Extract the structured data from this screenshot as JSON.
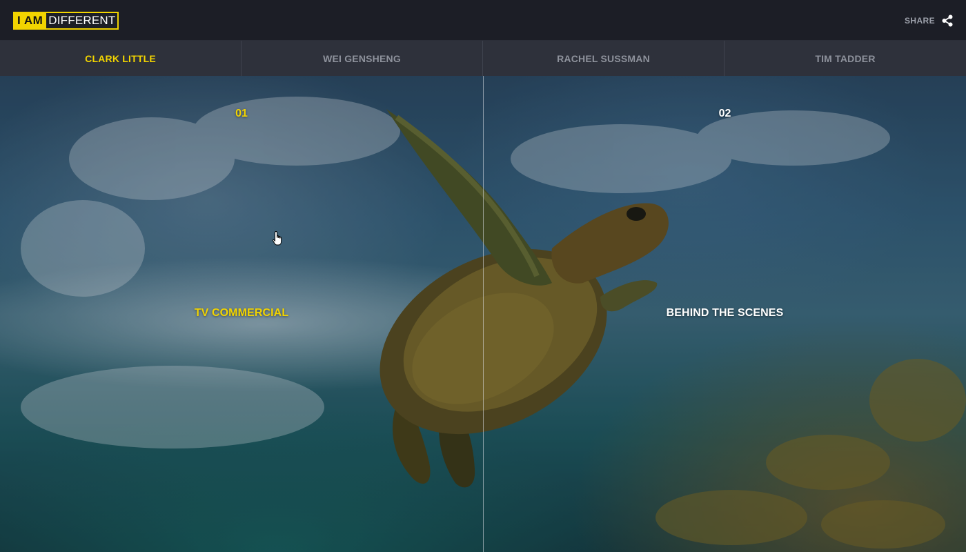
{
  "logo": {
    "part1": "I AM",
    "part2": "DIFFERENT"
  },
  "header": {
    "share_label": "SHARE"
  },
  "tabs": [
    {
      "label": "CLARK LITTLE",
      "active": true
    },
    {
      "label": "WEI GENSHENG",
      "active": false
    },
    {
      "label": "RACHEL SUSSMAN",
      "active": false
    },
    {
      "label": "TIM TADDER",
      "active": false
    }
  ],
  "panels": [
    {
      "number": "01",
      "title": "TV COMMERCIAL"
    },
    {
      "number": "02",
      "title": "BEHIND THE SCENES"
    }
  ],
  "colors": {
    "accent": "#f2d400",
    "header_bg": "#1c1e26",
    "tab_bg": "#2e313b"
  },
  "icons": [
    "share-icon",
    "hand-cursor-icon"
  ]
}
